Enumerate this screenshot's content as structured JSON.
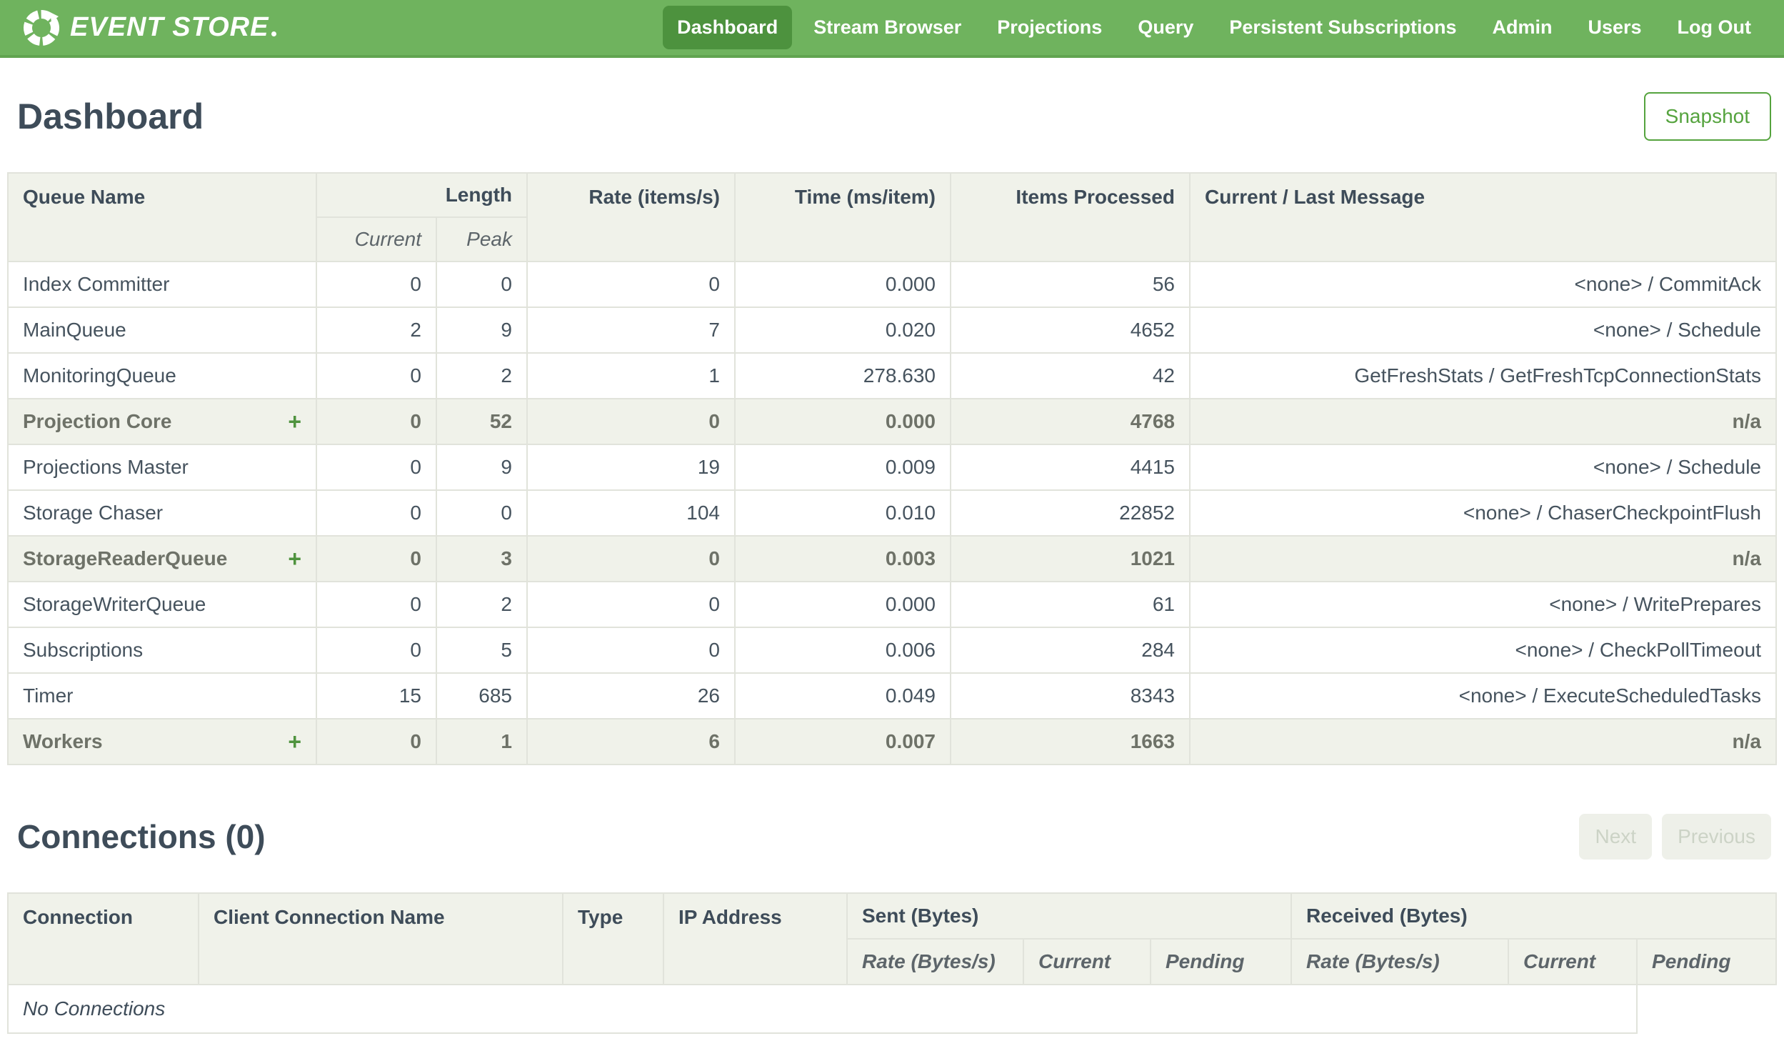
{
  "nav": {
    "brand": "EVENT STORE",
    "items": [
      {
        "label": "Dashboard",
        "active": true
      },
      {
        "label": "Stream Browser",
        "active": false
      },
      {
        "label": "Projections",
        "active": false
      },
      {
        "label": "Query",
        "active": false
      },
      {
        "label": "Persistent Subscriptions",
        "active": false
      },
      {
        "label": "Admin",
        "active": false
      },
      {
        "label": "Users",
        "active": false
      },
      {
        "label": "Log Out",
        "active": false
      }
    ]
  },
  "page": {
    "title": "Dashboard",
    "snapshot_button": "Snapshot"
  },
  "icons": {
    "expand_plus": "+"
  },
  "queue_table": {
    "headers": {
      "queue_name": "Queue Name",
      "length": "Length",
      "current": "Current",
      "peak": "Peak",
      "rate": "Rate (items/s)",
      "time": "Time (ms/item)",
      "items": "Items Processed",
      "message": "Current / Last Message"
    },
    "rows": [
      {
        "name": "Index Committer",
        "group": false,
        "current": "0",
        "peak": "0",
        "rate": "0",
        "time": "0.000",
        "items": "56",
        "message": "<none> / CommitAck"
      },
      {
        "name": "MainQueue",
        "group": false,
        "current": "2",
        "peak": "9",
        "rate": "7",
        "time": "0.020",
        "items": "4652",
        "message": "<none> / Schedule"
      },
      {
        "name": "MonitoringQueue",
        "group": false,
        "current": "0",
        "peak": "2",
        "rate": "1",
        "time": "278.630",
        "items": "42",
        "message": "GetFreshStats / GetFreshTcpConnectionStats"
      },
      {
        "name": "Projection Core",
        "group": true,
        "current": "0",
        "peak": "52",
        "rate": "0",
        "time": "0.000",
        "items": "4768",
        "message": "n/a"
      },
      {
        "name": "Projections Master",
        "group": false,
        "current": "0",
        "peak": "9",
        "rate": "19",
        "time": "0.009",
        "items": "4415",
        "message": "<none> / Schedule"
      },
      {
        "name": "Storage Chaser",
        "group": false,
        "current": "0",
        "peak": "0",
        "rate": "104",
        "time": "0.010",
        "items": "22852",
        "message": "<none> / ChaserCheckpointFlush"
      },
      {
        "name": "StorageReaderQueue",
        "group": true,
        "current": "0",
        "peak": "3",
        "rate": "0",
        "time": "0.003",
        "items": "1021",
        "message": "n/a"
      },
      {
        "name": "StorageWriterQueue",
        "group": false,
        "current": "0",
        "peak": "2",
        "rate": "0",
        "time": "0.000",
        "items": "61",
        "message": "<none> / WritePrepares"
      },
      {
        "name": "Subscriptions",
        "group": false,
        "current": "0",
        "peak": "5",
        "rate": "0",
        "time": "0.006",
        "items": "284",
        "message": "<none> / CheckPollTimeout"
      },
      {
        "name": "Timer",
        "group": false,
        "current": "15",
        "peak": "685",
        "rate": "26",
        "time": "0.049",
        "items": "8343",
        "message": "<none> / ExecuteScheduledTasks"
      },
      {
        "name": "Workers",
        "group": true,
        "current": "0",
        "peak": "1",
        "rate": "6",
        "time": "0.007",
        "items": "1663",
        "message": "n/a"
      }
    ]
  },
  "connections": {
    "title": "Connections (0)",
    "next_label": "Next",
    "previous_label": "Previous",
    "headers": {
      "connection": "Connection",
      "client_name": "Client Connection Name",
      "type": "Type",
      "ip": "IP Address",
      "sent": "Sent (Bytes)",
      "received": "Received (Bytes)",
      "rate": "Rate (Bytes/s)",
      "current": "Current",
      "pending": "Pending"
    },
    "empty_message": "No Connections"
  },
  "colors": {
    "nav_green": "#6fb35e",
    "nav_active_green": "#4d923e",
    "accent_green": "#55a33e",
    "heading_text": "#3e4c59",
    "body_text": "#46535e",
    "group_row_text": "#6e7268",
    "table_header_bg": "#f0f2ea",
    "table_border": "#e1e3db",
    "disabled_button_bg": "#eef0e9",
    "disabled_button_text": "#ccd3c6"
  }
}
